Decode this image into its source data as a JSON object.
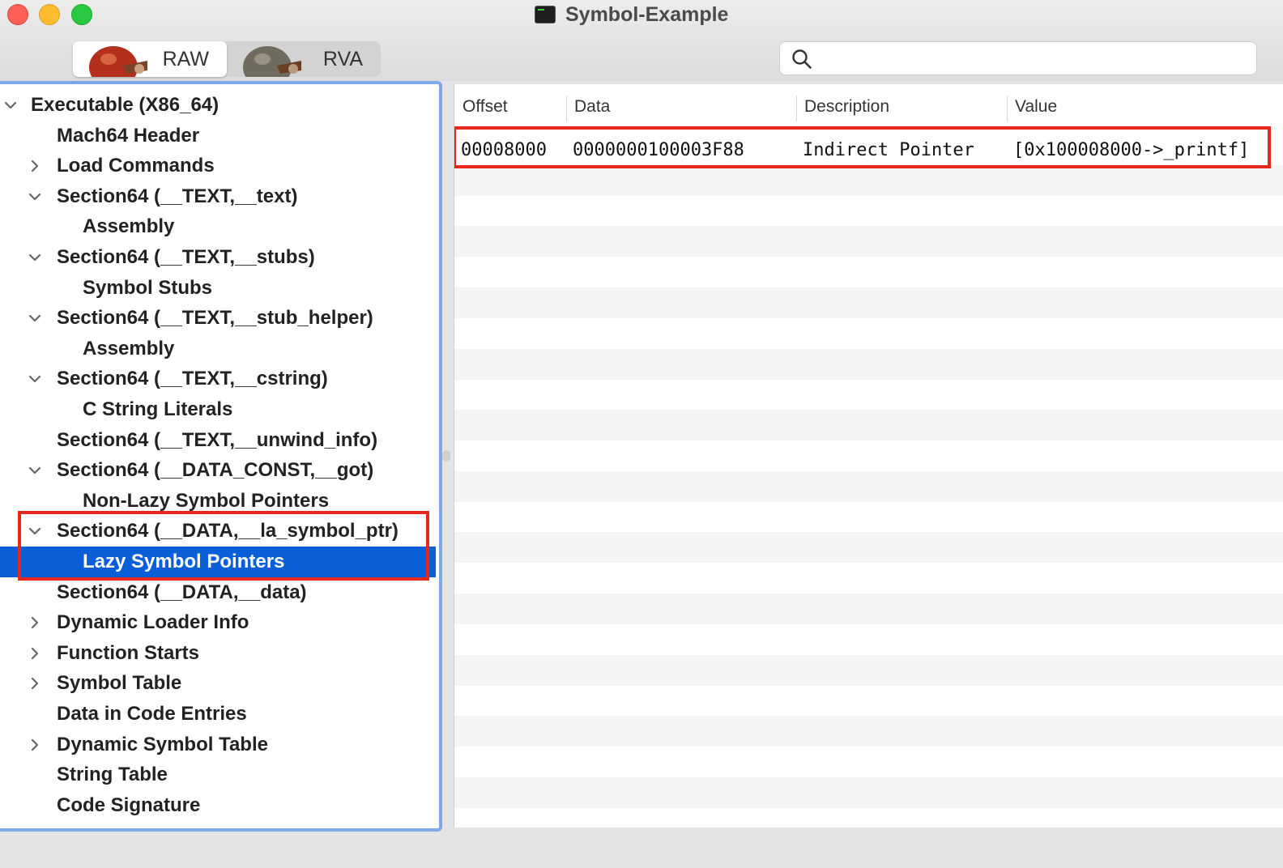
{
  "window": {
    "title": "Symbol-Example"
  },
  "toolbar": {
    "segments": [
      {
        "label": "RAW",
        "active": true,
        "icon": "apple-icon"
      },
      {
        "label": "RVA",
        "active": false,
        "icon": "apple-gray-icon"
      }
    ],
    "search": {
      "placeholder": "",
      "value": ""
    }
  },
  "sidebar": {
    "items": [
      {
        "label": "Executable  (X86_64)",
        "chevron": "down"
      },
      {
        "label": "Mach64 Header",
        "chevron": "none"
      },
      {
        "label": "Load Commands",
        "chevron": "right"
      },
      {
        "label": "Section64 (__TEXT,__text)",
        "chevron": "down"
      },
      {
        "label": "Assembly",
        "chevron": "none"
      },
      {
        "label": "Section64 (__TEXT,__stubs)",
        "chevron": "down"
      },
      {
        "label": "Symbol Stubs",
        "chevron": "none"
      },
      {
        "label": "Section64 (__TEXT,__stub_helper)",
        "chevron": "down"
      },
      {
        "label": "Assembly",
        "chevron": "none"
      },
      {
        "label": "Section64 (__TEXT,__cstring)",
        "chevron": "down"
      },
      {
        "label": "C String Literals",
        "chevron": "none"
      },
      {
        "label": "Section64 (__TEXT,__unwind_info)",
        "chevron": "none"
      },
      {
        "label": "Section64 (__DATA_CONST,__got)",
        "chevron": "down"
      },
      {
        "label": "Non-Lazy Symbol Pointers",
        "chevron": "none"
      },
      {
        "label": "Section64 (__DATA,__la_symbol_ptr)",
        "chevron": "down"
      },
      {
        "label": "Lazy Symbol Pointers",
        "chevron": "none",
        "selected": true
      },
      {
        "label": "Section64 (__DATA,__data)",
        "chevron": "none"
      },
      {
        "label": "Dynamic Loader Info",
        "chevron": "right"
      },
      {
        "label": "Function Starts",
        "chevron": "right"
      },
      {
        "label": "Symbol Table",
        "chevron": "right"
      },
      {
        "label": "Data in Code Entries",
        "chevron": "none"
      },
      {
        "label": "Dynamic Symbol Table",
        "chevron": "right"
      },
      {
        "label": "String Table",
        "chevron": "none"
      },
      {
        "label": "Code Signature",
        "chevron": "none"
      }
    ]
  },
  "table": {
    "columns": [
      "Offset",
      "Data",
      "Description",
      "Value"
    ],
    "rows": [
      [
        "00008000",
        "0000000100003F88",
        "Indirect Pointer",
        "[0x100008000->_printf]"
      ]
    ]
  },
  "colors": {
    "selection": "#0a5fd8",
    "highlight_box": "#e8281c",
    "sidebar_border": "#7fa7ea"
  }
}
